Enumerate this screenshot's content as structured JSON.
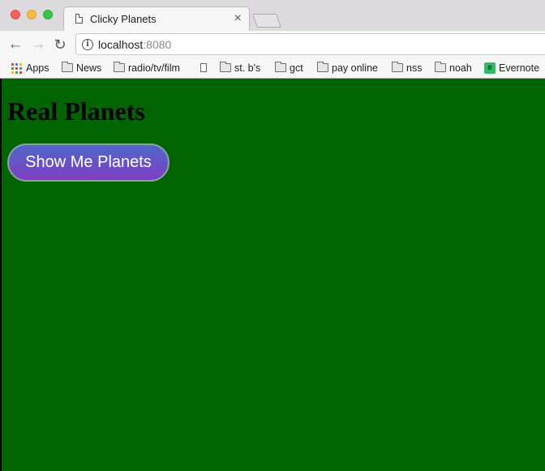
{
  "browser": {
    "tab": {
      "title": "Clicky Planets",
      "close_glyph": "×"
    },
    "toolbar": {
      "back_glyph": "←",
      "forward_glyph": "→",
      "reload_glyph": "↻",
      "info_glyph": "i",
      "url_host": "localhost",
      "url_port": ":8080"
    },
    "bookmarks": [
      {
        "label": "Apps",
        "icon": "apps-grid-icon"
      },
      {
        "label": "News",
        "icon": "folder-icon"
      },
      {
        "label": "radio/tv/film",
        "icon": "folder-icon"
      },
      {
        "label": "",
        "icon": "page-icon"
      },
      {
        "label": "st. b's",
        "icon": "folder-icon"
      },
      {
        "label": "gct",
        "icon": "folder-icon"
      },
      {
        "label": "pay online",
        "icon": "folder-icon"
      },
      {
        "label": "nss",
        "icon": "folder-icon"
      },
      {
        "label": "noah",
        "icon": "folder-icon"
      },
      {
        "label": "Evernote",
        "icon": "evernote-icon"
      }
    ]
  },
  "page": {
    "background_color": "#006400",
    "heading": "Real Planets",
    "button_label": "Show Me Planets",
    "button_gradient": [
      "#4f67c9",
      "#7e3fc4"
    ]
  }
}
